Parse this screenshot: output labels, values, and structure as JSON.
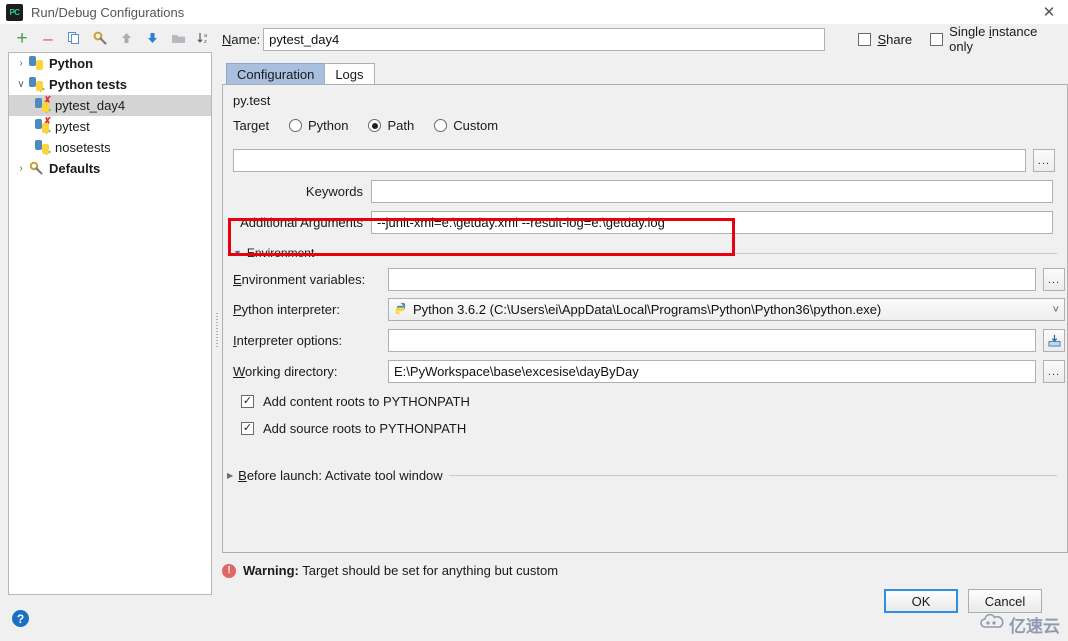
{
  "window": {
    "title": "Run/Debug Configurations",
    "logo_text": "PC",
    "close_label": "✕"
  },
  "toolbar": {
    "items": [
      {
        "name": "add-button",
        "glyph": "+",
        "color": "#499c54"
      },
      {
        "name": "remove-button",
        "glyph": "–",
        "color": "#c75450"
      },
      {
        "name": "copy-button",
        "glyph": "❐",
        "color": "#5b8fc9"
      },
      {
        "name": "edit-templates-button",
        "glyph": "⚒",
        "color": "#c8a13a"
      },
      {
        "name": "move-up-button",
        "glyph": "↑",
        "color": "#9aa0a6"
      },
      {
        "name": "move-down-button",
        "glyph": "↓",
        "color": "#2f7fd0"
      },
      {
        "name": "new-folder-button",
        "glyph": "▬",
        "color": "#a8aeb4"
      },
      {
        "name": "sort-alphabetically-button",
        "glyph": "↓ᵃ",
        "color": "#5a5a5a"
      }
    ]
  },
  "sidebar": {
    "items": [
      {
        "label": "Python",
        "indent": 0,
        "twisty": "›",
        "bold": true,
        "selected": false,
        "icon": "python-icon",
        "error": false
      },
      {
        "label": "Python tests",
        "indent": 0,
        "twisty": "∨",
        "bold": true,
        "selected": false,
        "icon": "python-tests-icon",
        "error": false
      },
      {
        "label": "pytest_day4",
        "indent": 1,
        "twisty": "",
        "bold": false,
        "selected": true,
        "icon": "pytest-icon",
        "error": true
      },
      {
        "label": "pytest",
        "indent": 1,
        "twisty": "",
        "bold": false,
        "selected": false,
        "icon": "pytest-icon",
        "error": true
      },
      {
        "label": "nosetests",
        "indent": 1,
        "twisty": "",
        "bold": false,
        "selected": false,
        "icon": "nosetests-icon",
        "error": false
      },
      {
        "label": "Defaults",
        "indent": 0,
        "twisty": "›",
        "bold": true,
        "selected": false,
        "icon": "defaults-wrench-icon",
        "error": false
      }
    ]
  },
  "form": {
    "name_label": "Name:",
    "name_mnemonic": "N",
    "name_value": "pytest_day4",
    "share_label": "Share",
    "share_checked": false,
    "single_instance_label": "Single instance only",
    "single_instance_checked": false,
    "tabs": [
      {
        "label": "Configuration",
        "active": true
      },
      {
        "label": "Logs",
        "active": false
      }
    ],
    "section_title": "py.test",
    "target_label": "Target",
    "target_options": [
      {
        "label": "Python",
        "selected": false
      },
      {
        "label": "Path",
        "selected": true
      },
      {
        "label": "Custom",
        "selected": false
      }
    ],
    "target_path_value": "",
    "keywords_label": "Keywords",
    "keywords_value": "",
    "additional_args_label": "Additional Arguments",
    "additional_args_value": "--junit-xml=e:\\getday.xml  --result-log=e:\\getday.log",
    "environment_section_label": "Environment",
    "environment_collapsed": false,
    "env_vars_label": "Environment variables:",
    "env_vars_value": "",
    "interpreter_label": "Python interpreter:",
    "interpreter_value": "Python 3.6.2 (C:\\Users\\ei\\AppData\\Local\\Programs\\Python\\Python36\\python.exe)",
    "interpreter_options_label": "Interpreter options:",
    "interpreter_options_value": "",
    "working_dir_label": "Working directory:",
    "working_dir_value": "E:\\PyWorkspace\\base\\excesise\\dayByDay",
    "add_content_roots_label": "Add content roots to PYTHONPATH",
    "add_content_roots_checked": true,
    "add_source_roots_label": "Add source roots to PYTHONPATH",
    "add_source_roots_checked": true,
    "before_launch_label": "Before launch: Activate tool window",
    "before_launch_collapsed": true,
    "browse_glyph": "...",
    "checkmark": "✓",
    "dropdown_glyph": "∨"
  },
  "status": {
    "warning_prefix": "Warning:",
    "warning_text": "Target should be set for anything but custom",
    "warning_icon_glyph": "!"
  },
  "footer": {
    "help_glyph": "?",
    "ok_label": "OK",
    "cancel_label": "Cancel"
  },
  "watermark": {
    "text": "亿速云",
    "logo_glyph": "☁"
  },
  "colors": {
    "accent_tab": "#a8bfe0",
    "annotation_red": "#e8000f",
    "warning_red": "#e06666",
    "focus_blue": "#2f8fe0",
    "help_blue": "#1a6fc4"
  }
}
